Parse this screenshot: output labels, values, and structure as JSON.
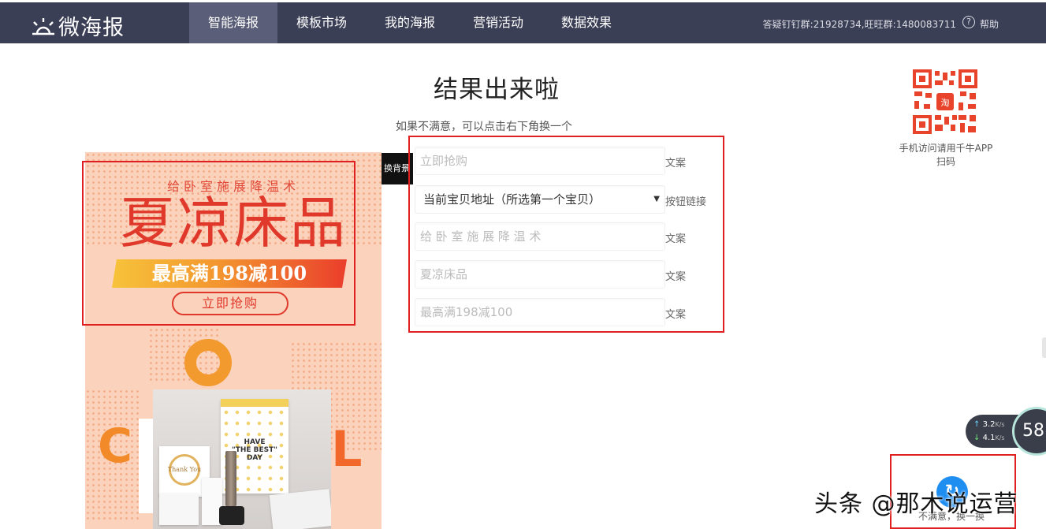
{
  "header": {
    "logo_text": "微海报",
    "nav": [
      {
        "label": "智能海报",
        "active": true
      },
      {
        "label": "模板市场",
        "active": false
      },
      {
        "label": "我的海报",
        "active": false
      },
      {
        "label": "营销活动",
        "active": false
      },
      {
        "label": "数据效果",
        "active": false
      }
    ],
    "support_info": "答疑钉钉群:21928734,旺旺群:1480083711",
    "help_label": "帮助"
  },
  "main": {
    "title": "结果出来啦",
    "subtitle": "如果不满意，可以点击右下角换一个"
  },
  "qr": {
    "caption": "手机访问请用千牛APP扫码",
    "accent": "#e8432b"
  },
  "poster": {
    "subtitle": "给卧室施展降温术",
    "title": "夏凉床品",
    "band": "最高满198减100",
    "button": "立即抢购",
    "letter_c": "C",
    "letter_l": "L",
    "product_bag_text": "HAVE\n\"THE BEST\"\nDAY",
    "product_card_text": "Thank You",
    "colors": {
      "bg": "#fbd3bd",
      "title": "#e0392b",
      "band_start": "#f7c33a",
      "band_end": "#ea3e2c"
    }
  },
  "swap_background_label": "换背景",
  "form": {
    "fields": [
      {
        "placeholder": "立即抢购",
        "label": "文案"
      },
      {
        "value": "当前宝贝地址（所选第一个宝贝）",
        "label": "按钮链接",
        "type": "select"
      },
      {
        "placeholder": "给 卧 室 施 展 降 温 术",
        "label": "文案"
      },
      {
        "placeholder": "夏凉床品",
        "label": "文案"
      },
      {
        "placeholder": "最高满198减100",
        "label": "文案"
      }
    ]
  },
  "widgets": {
    "upload_speed": "3.2",
    "download_speed": "4.1",
    "speed_unit": "K/s",
    "gauge_value": "58",
    "swap_button_label": "不满意，换一换",
    "watermark": "头条 @那木说运营"
  }
}
